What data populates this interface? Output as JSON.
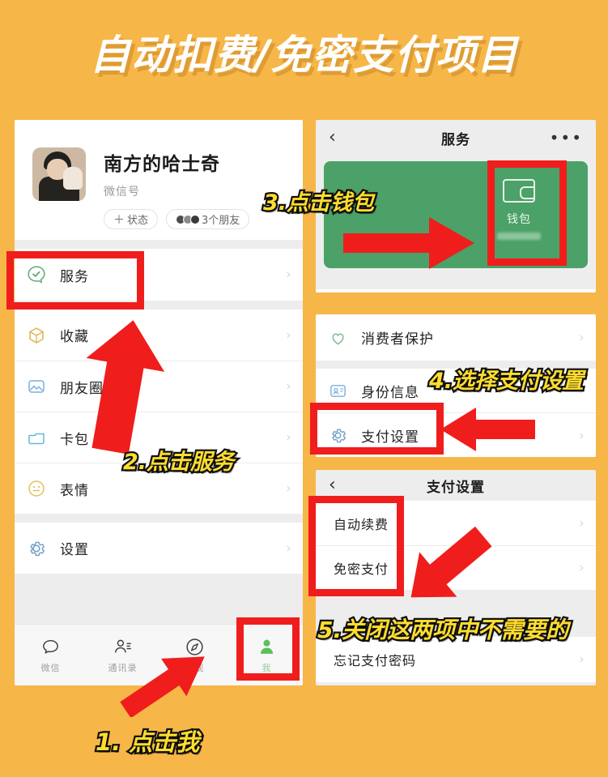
{
  "title": "自动扣费/免密支付项目",
  "colors": {
    "background": "#f7b648",
    "highlight_red": "#f01d1d",
    "annotation_yellow": "#ffdd2e",
    "wallet_card_green": "#4ba167",
    "wechat_green": "#5ac05a"
  },
  "profile": {
    "name": "南方的哈士奇",
    "wxid_label": "微信号",
    "status_chip": "状态",
    "status_plus": "＋",
    "friends_chip": "3个朋友"
  },
  "left_panel": {
    "menu": [
      {
        "label": "服务",
        "icon": "service-check-icon",
        "chevron": "›"
      },
      {
        "label": "收藏",
        "icon": "favorites-box-icon",
        "chevron": "›"
      },
      {
        "label": "朋友圈",
        "icon": "moments-photo-icon",
        "chevron": "›"
      },
      {
        "label": "卡包",
        "icon": "cards-wallet-icon",
        "chevron": "›"
      },
      {
        "label": "表情",
        "icon": "emoji-smiley-icon",
        "chevron": "›"
      },
      {
        "label": "设置",
        "icon": "settings-gear-icon",
        "chevron": "›"
      }
    ],
    "tabbar": [
      {
        "label": "微信",
        "icon": "chat-bubble-icon",
        "active": false
      },
      {
        "label": "通讯录",
        "icon": "contacts-icon",
        "active": false
      },
      {
        "label": "发现",
        "icon": "discover-compass-icon",
        "active": false
      },
      {
        "label": "我",
        "icon": "me-person-icon",
        "active": true
      }
    ]
  },
  "service_panel": {
    "nav": {
      "back": "‹",
      "title": "服务",
      "more": "•••"
    },
    "wallet_tile": {
      "icon": "wallet-icon",
      "label": "钱包",
      "amount_masked": ""
    }
  },
  "wallet_panel": {
    "rows": [
      {
        "label": "消费者保护",
        "icon": "consumer-protection-icon",
        "chevron": "›"
      },
      {
        "label": "身份信息",
        "icon": "identity-card-icon",
        "chevron": "›"
      },
      {
        "label": "支付设置",
        "icon": "payment-settings-gear-icon",
        "chevron": "›"
      }
    ]
  },
  "paysettings_panel": {
    "nav": {
      "back": "‹",
      "title": "支付设置"
    },
    "rows": [
      {
        "label": "自动续费",
        "chevron": "›"
      },
      {
        "label": "免密支付",
        "chevron": "›"
      },
      {
        "label": "忘记支付密码",
        "chevron": "›"
      }
    ]
  },
  "annotations": {
    "step1": "1. 点击我",
    "step2": "2.点击服务",
    "step3": "3.点击钱包",
    "step4": "4.选择支付设置",
    "step5": "5.关闭这两项中不需要的"
  }
}
